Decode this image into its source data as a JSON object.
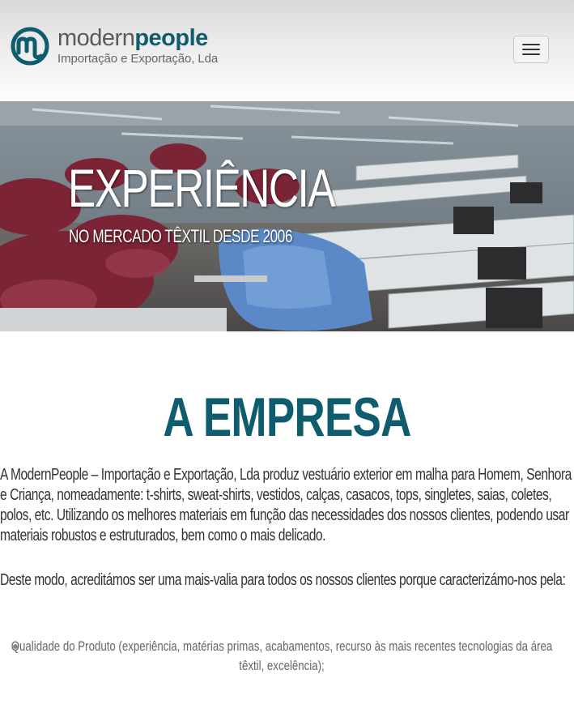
{
  "header": {
    "brand_part1": "modern",
    "brand_part2": "people",
    "tagline": "Importação e Exportação, Lda",
    "menu_label": "menu-icon"
  },
  "hero": {
    "title": "EXPERIÊNCIA",
    "subtitle": "NO MERCADO TÊXTIL DESDE 2006"
  },
  "company": {
    "title": "A EMPRESA",
    "paragraph1": "A ModernPeople – Importação e Exportação, Lda produz vestuário exterior em malha para Homem, Senhora e Criança, nomeadamente: t-shirts, sweat-shirts, vestidos, calças, casacos, tops, singletes, saias, coletes, polos, etc. Utilizando os melhores materiais em função das necessidades dos nossos clientes, podendo usar materiais robustos e estruturados, bem como o mais delicado.",
    "paragraph2": "Deste modo, acreditámos ser uma mais-valia para todos os nossos clientes porque caracterizámo-nos pela:",
    "bullets": [
      "Qualidade do Produto (experiência, matérias primas, acabamentos, recurso às mais recentes tecnologias da área têxtil, excelência);"
    ]
  },
  "colors": {
    "brand": "#0f5c6e",
    "brand_grey": "#5a5a5a"
  }
}
